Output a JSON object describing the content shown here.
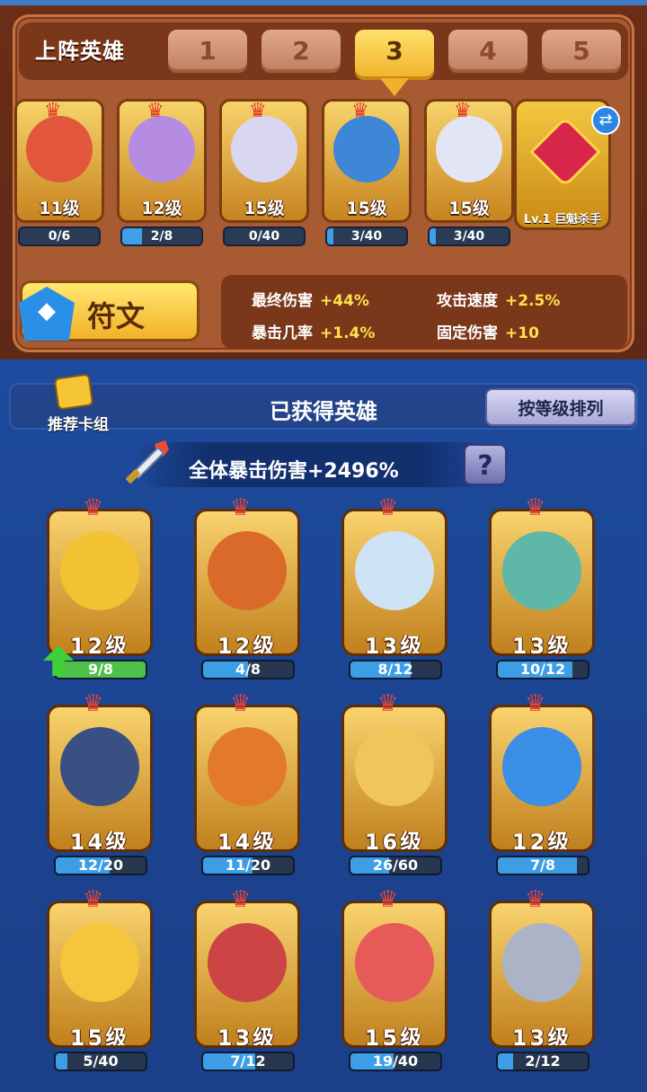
{
  "lineup": {
    "title": "上阵英雄",
    "tabs": [
      "1",
      "2",
      "3",
      "4",
      "5"
    ],
    "active_tab": 2,
    "heroes": [
      {
        "level": "11级",
        "progress": "0/6",
        "fill": 0,
        "color": "#e2563c"
      },
      {
        "level": "12级",
        "progress": "2/8",
        "fill": 0.25,
        "color": "#b68ce2"
      },
      {
        "level": "15级",
        "progress": "0/40",
        "fill": 0,
        "color": "#d9d6f2"
      },
      {
        "level": "15级",
        "progress": "3/40",
        "fill": 0.075,
        "color": "#3e86d6"
      },
      {
        "level": "15级",
        "progress": "3/40",
        "fill": 0.075,
        "color": "#e2e6f4"
      }
    ],
    "item": {
      "label": "Lv.1 巨魁杀手",
      "icon": "heart-gem-icon"
    },
    "swap_icon": "⇄"
  },
  "rune": {
    "label": "符文",
    "icon": "rune-gem-icon"
  },
  "stats": [
    {
      "name": "最终伤害",
      "value": "+44%"
    },
    {
      "name": "攻击速度",
      "value": "+2.5%"
    },
    {
      "name": "暴击几率",
      "value": "+1.4%"
    },
    {
      "name": "固定伤害",
      "value": "+10"
    }
  ],
  "obtained": {
    "title": "已获得英雄",
    "deck_label": "推荐卡组",
    "sort_label": "按等级排列",
    "crit_text": "全体暴击伤害+2496%",
    "help_label": "?",
    "heroes": [
      {
        "level": "12级",
        "progress": "9/8",
        "fill": 1,
        "full": true,
        "color": "#f2c233"
      },
      {
        "level": "12级",
        "progress": "4/8",
        "fill": 0.5,
        "color": "#d96a2a"
      },
      {
        "level": "13级",
        "progress": "8/12",
        "fill": 0.67,
        "color": "#cfe3f6"
      },
      {
        "level": "13级",
        "progress": "10/12",
        "fill": 0.83,
        "color": "#5fb7a7"
      },
      {
        "level": "14级",
        "progress": "12/20",
        "fill": 0.6,
        "color": "#3a4f82"
      },
      {
        "level": "14级",
        "progress": "11/20",
        "fill": 0.55,
        "color": "#e27a2a"
      },
      {
        "level": "16级",
        "progress": "26/60",
        "fill": 0.43,
        "color": "#f0c55a"
      },
      {
        "level": "12级",
        "progress": "7/8",
        "fill": 0.875,
        "color": "#3a8ee6"
      },
      {
        "level": "15级",
        "progress": "5/40",
        "fill": 0.125,
        "color": "#f5c53c"
      },
      {
        "level": "13级",
        "progress": "7/12",
        "fill": 0.58,
        "color": "#cc4444"
      },
      {
        "level": "15级",
        "progress": "19/40",
        "fill": 0.475,
        "color": "#e65a5a"
      },
      {
        "level": "13级",
        "progress": "2/12",
        "fill": 0.17,
        "color": "#aab4c6"
      }
    ]
  }
}
